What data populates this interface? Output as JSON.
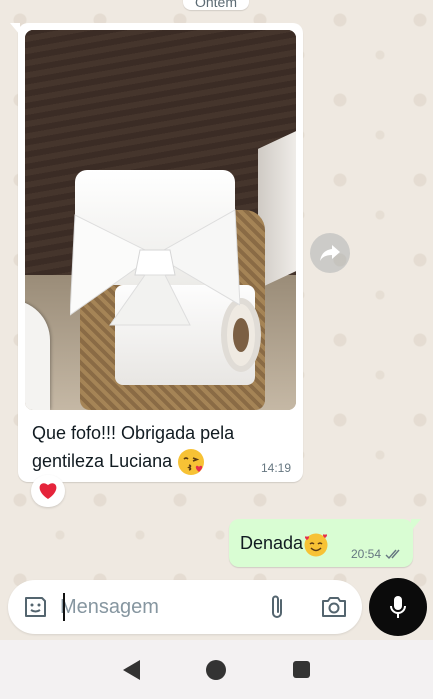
{
  "chat": {
    "date_chip": "Ontem",
    "incoming": {
      "text_line1": "Que fofo!!! Obrigada pela",
      "text_line2": "gentileza Luciana",
      "emoji": "kissing-face-with-heart",
      "time": "14:19",
      "reaction": "❤️"
    },
    "outgoing": {
      "text": "Denada",
      "emoji": "smiling-face-with-hearts",
      "time": "20:54",
      "status": "read"
    }
  },
  "composer": {
    "placeholder": "Mensagem",
    "icons": [
      "sticker-icon",
      "attach-icon",
      "camera-icon",
      "mic-icon"
    ]
  },
  "colors": {
    "outgoing_bubble": "#d9fdd3",
    "incoming_bubble": "#ffffff",
    "read_ticks": "#667781",
    "mic_button": "#0b0b0b"
  },
  "navigation": [
    "back",
    "home",
    "recents"
  ]
}
